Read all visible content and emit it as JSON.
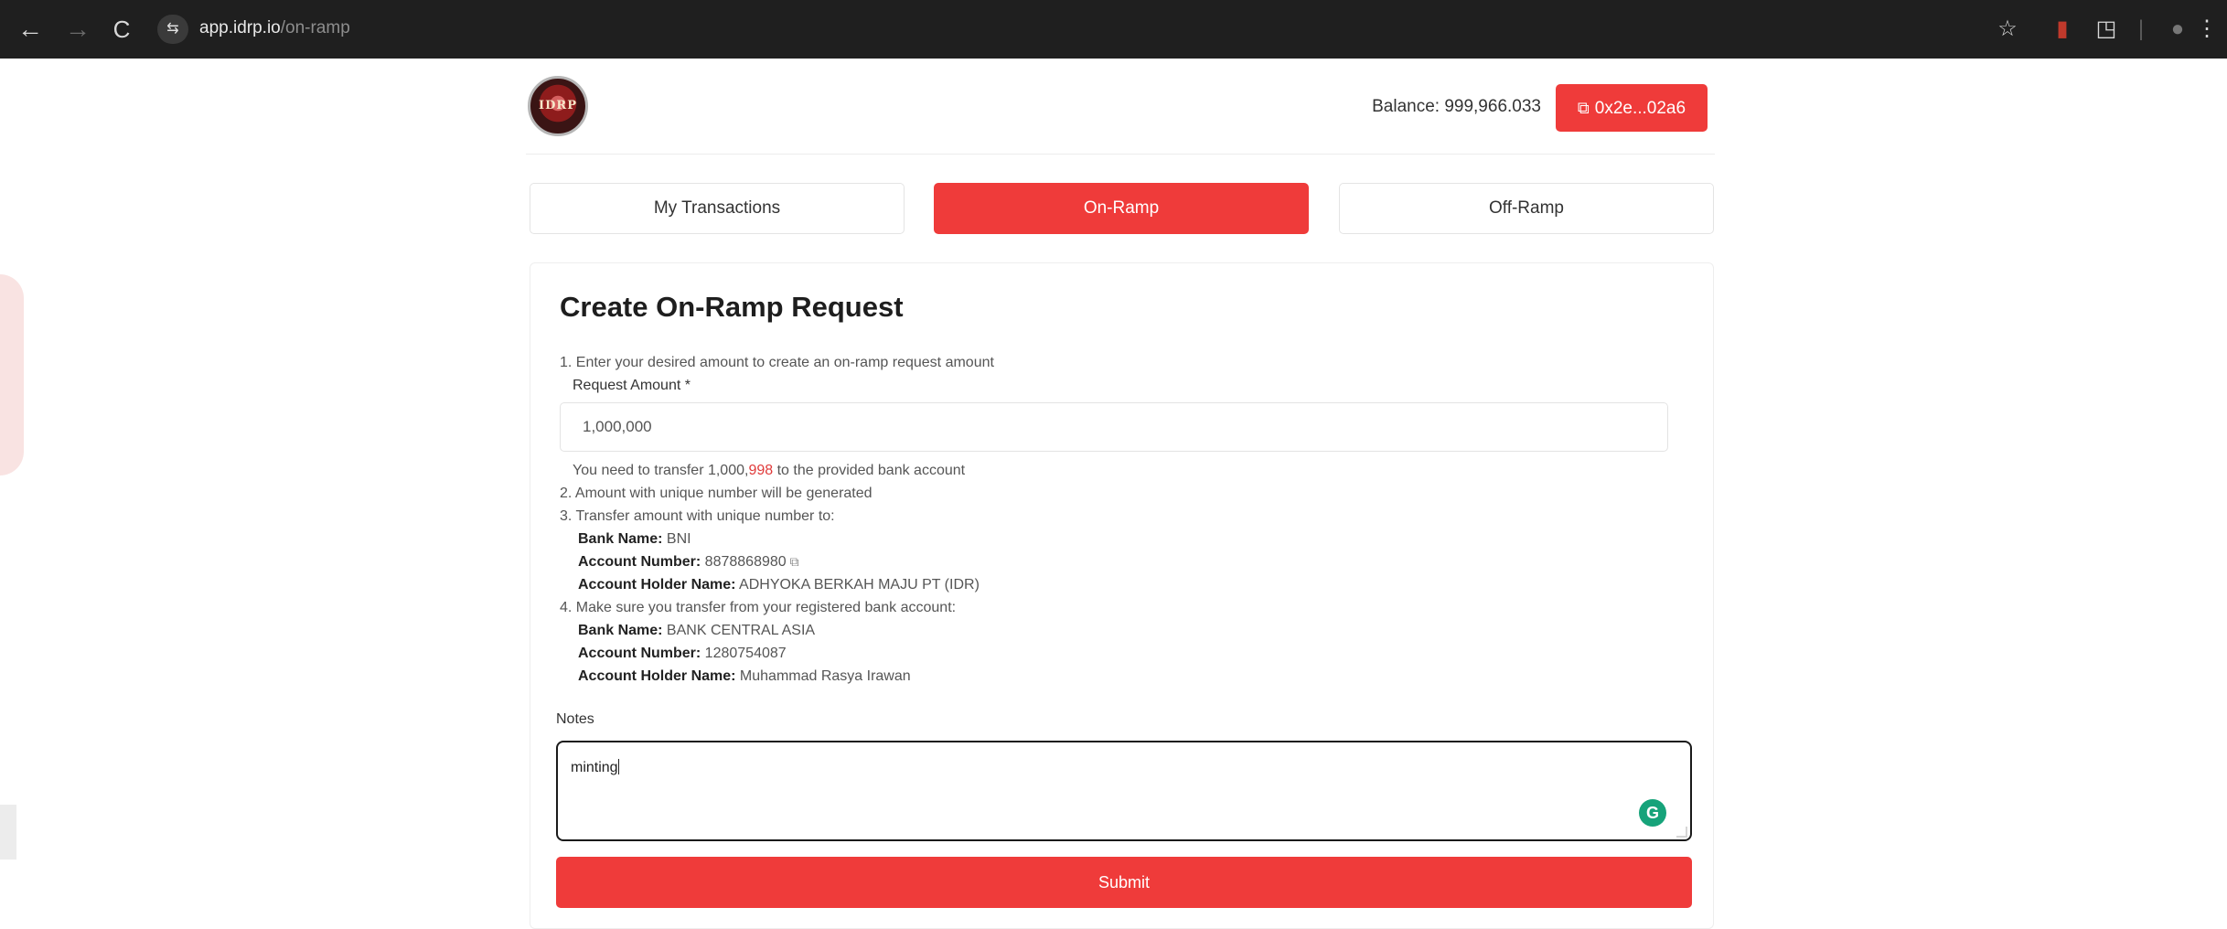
{
  "browser": {
    "back_icon": "←",
    "forward_icon": "→",
    "reload_icon": "C",
    "site_info_icon": "⇆",
    "url_host": "app.idrp.io",
    "url_path": "/on-ramp",
    "star_icon": "☆",
    "extension_icon": "▮",
    "extensions_icon": "◳",
    "menu_icon": "⋮"
  },
  "header": {
    "logo_text": "IDRP",
    "balance_label": "Balance: 999,966.033",
    "wallet_label": "0x2e...02a6"
  },
  "tabs": [
    {
      "label": "My Transactions",
      "active": false
    },
    {
      "label": "On-Ramp",
      "active": true
    },
    {
      "label": "Off-Ramp",
      "active": false
    }
  ],
  "form": {
    "title": "Create On-Ramp Request",
    "step1": "1. Enter your desired amount to create an on-ramp request amount",
    "request_amount_label": "Request Amount *",
    "request_amount_value": "1,000,000",
    "transfer_note_prefix": "You need to transfer 1,000,",
    "transfer_note_highlight": "998",
    "transfer_note_suffix": " to the provided bank account",
    "step2": "2. Amount with unique number will be generated",
    "step3": "3. Transfer amount with unique number to:",
    "dest_bank_label": "Bank Name:",
    "dest_bank_value": " BNI",
    "dest_account_label": "Account Number:",
    "dest_account_value": " 8878868980",
    "dest_holder_label": "Account Holder Name:",
    "dest_holder_value": " ADHYOKA BERKAH MAJU PT (IDR)",
    "step4": "4. Make sure you transfer from your registered bank account:",
    "src_bank_label": "Bank Name:",
    "src_bank_value": " BANK CENTRAL ASIA",
    "src_account_label": "Account Number:",
    "src_account_value": " 1280754087",
    "src_holder_label": "Account Holder Name:",
    "src_holder_value": " Muhammad Rasya Irawan",
    "notes_label": "Notes",
    "notes_value": "minting",
    "grammarly_icon": "G",
    "submit_label": "Submit"
  },
  "colors": {
    "accent": "#ef3b3a",
    "highlight": "#e03a3a"
  }
}
